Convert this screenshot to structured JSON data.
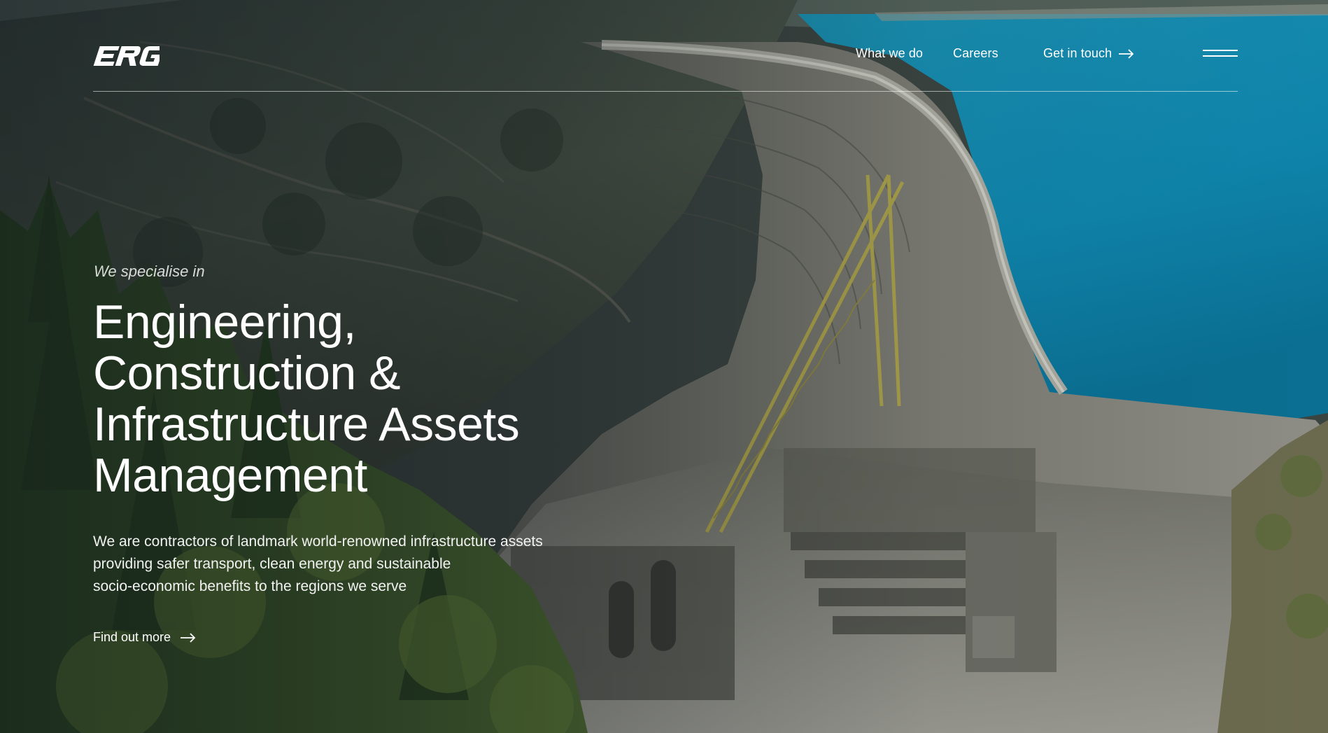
{
  "header": {
    "logo_alt": "ERG",
    "nav": [
      {
        "label": "What we do"
      },
      {
        "label": "Careers"
      },
      {
        "label": "Get in touch"
      }
    ]
  },
  "hero": {
    "eyebrow": "We specialise in",
    "headline_lines": [
      "Engineering,",
      "Construction &",
      "Infrastructure Assets",
      "Management"
    ],
    "intro_lines": [
      "We are contractors of landmark world-renowned infrastructure assets",
      "providing safer transport, clean energy and sustainable",
      "socio-economic benefits to the regions we serve"
    ],
    "cta_label": "Find out more"
  },
  "icons": {
    "contact_arrow": "arrow-right-icon",
    "cta_arrow": "arrow-right-icon",
    "menu": "hamburger-menu-icon"
  },
  "colors": {
    "reservoir": "#1391b6",
    "text": "#ffffff"
  }
}
